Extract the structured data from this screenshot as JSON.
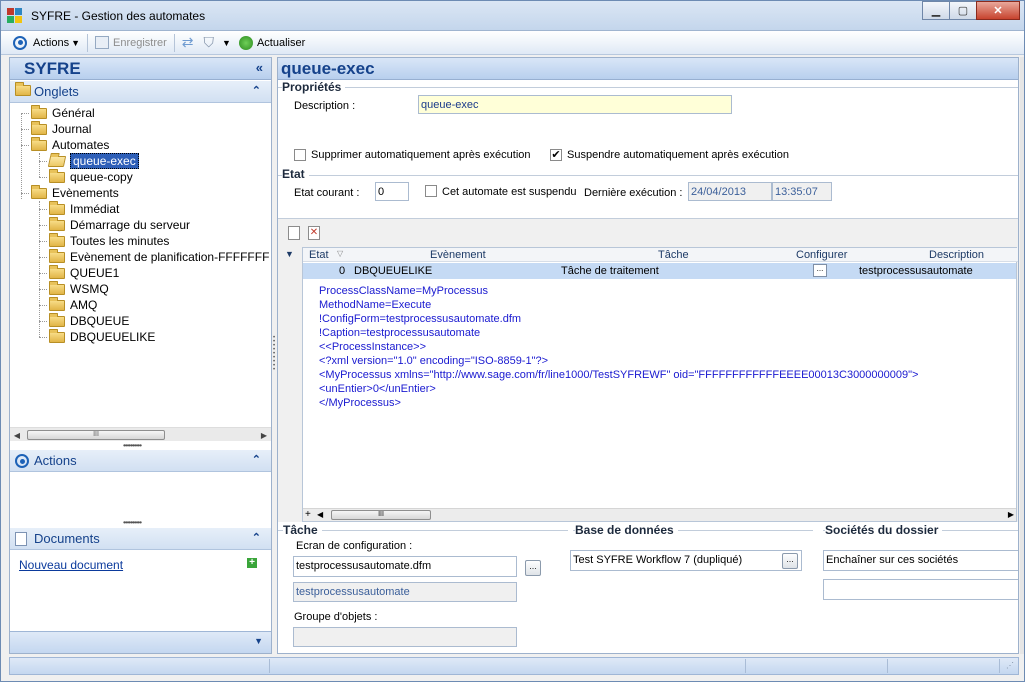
{
  "window": {
    "title": "SYFRE -  Gestion des automates"
  },
  "toolbar": {
    "actions": "Actions",
    "save": "Enregistrer",
    "refresh": "Actualiser"
  },
  "left": {
    "title": "SYFRE",
    "collapse_glyph": "«",
    "onglets": "Onglets",
    "tree": {
      "general": "Général",
      "journal": "Journal",
      "automates": "Automates",
      "queue_exec": "queue-exec",
      "queue_copy": "queue-copy",
      "evenements": "Evènements",
      "immediat": "Immédiat",
      "demarrage": "Démarrage du serveur",
      "minutes": "Toutes les minutes",
      "planif": "Evènement de planification-FFFFFFF",
      "queue1": "QUEUE1",
      "wsmq": "WSMQ",
      "amq": "AMQ",
      "dbqueue": "DBQUEUE",
      "dbqueuelike": "DBQUEUELIKE"
    },
    "actions": "Actions",
    "documents": "Documents",
    "new_doc": "Nouveau document"
  },
  "right": {
    "title": "queue-exec",
    "proprietes": "Propriétés",
    "description_label": "Description :",
    "description_value": "queue-exec",
    "chk_supprimer": "Supprimer automatiquement après exécution",
    "chk_suspendre": "Suspendre automatiquement après exécution",
    "supprimer_checked": false,
    "suspendre_checked": true,
    "etat": "Etat",
    "etat_courant_label": "Etat courant :",
    "etat_courant_value": "0",
    "chk_suspendu": "Cet automate est suspendu",
    "suspendu_checked": false,
    "derniere_label": "Dernière exécution :",
    "derniere_date": "24/04/2013",
    "derniere_heure": "13:35:07",
    "grid": {
      "headers": {
        "etat": "Etat",
        "evenement": "Evènement",
        "tache": "Tâche",
        "configurer": "Configurer",
        "description": "Description"
      },
      "row": {
        "etat": "0",
        "evenement": "DBQUEUELIKE",
        "tache": "Tâche de traitement",
        "configurer": "...",
        "description": "testprocessusautomate"
      },
      "xml": [
        "ProcessClassName=MyProcessus",
        "MethodName=Execute",
        "!ConfigForm=testprocessusautomate.dfm",
        "!Caption=testprocessusautomate",
        "<<ProcessInstance>>",
        "<?xml version=\"1.0\" encoding=\"ISO-8859-1\"?>",
        "<MyProcessus xmlns=\"http://www.sage.com/fr/line1000/TestSYFREWF\" oid=\"FFFFFFFFFFFFEEEE00013C3000000009\">",
        "<unEntier>0</unEntier>",
        "</MyProcessus>"
      ]
    },
    "tache": "Tâche",
    "ecran_label": "Ecran de configuration :",
    "ecran_value": "testprocessusautomate.dfm",
    "ecran_value2": "testprocessusautomate",
    "groupe_label": "Groupe d'objets :",
    "groupe_value": "",
    "base": "Base de données",
    "base_value": "Test SYFRE Workflow 7 (dupliqué)",
    "societes": "Sociétés du dossier",
    "societes_value": "Enchaîner sur ces sociétés",
    "societes_value2": ""
  }
}
